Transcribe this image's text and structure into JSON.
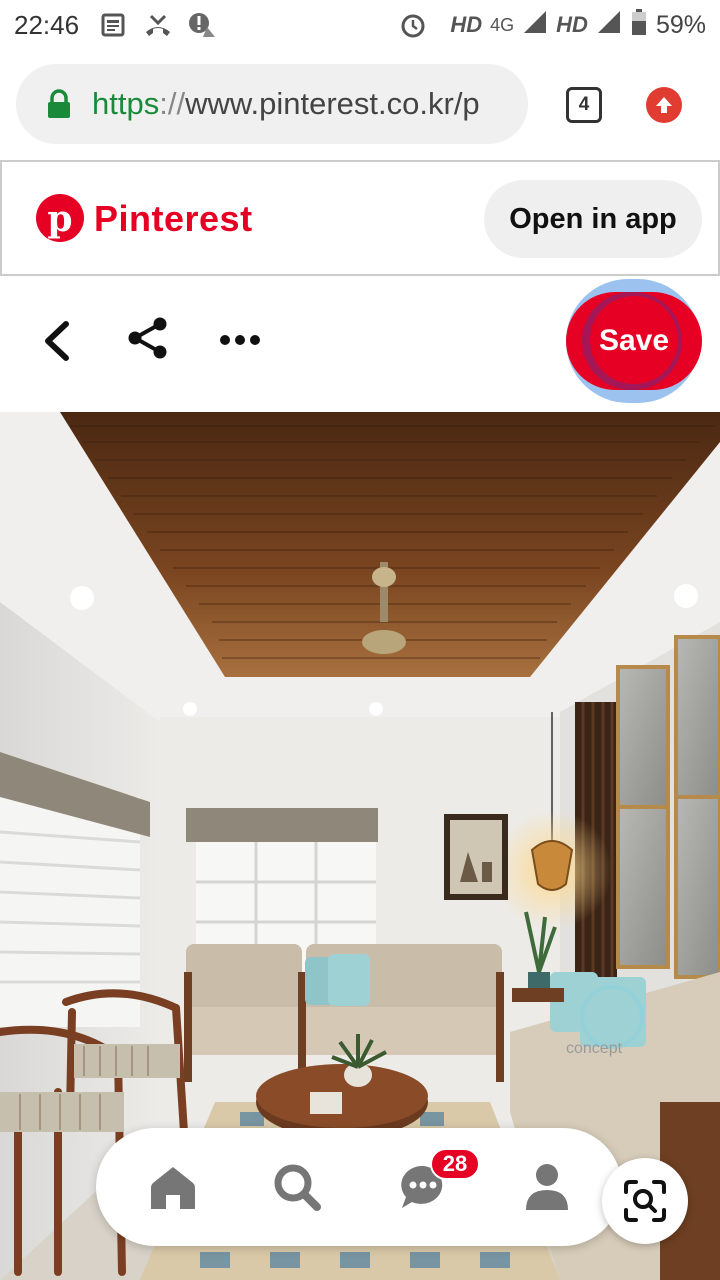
{
  "status_bar": {
    "time": "22:46",
    "network_1": "HD",
    "network_type": "4G",
    "network_2": "HD",
    "battery": "59%",
    "icons": [
      "news-icon",
      "missed-call-icon",
      "alert-icon",
      "alarm-icon",
      "signal-icon",
      "battery-icon"
    ]
  },
  "browser": {
    "url_scheme": "https",
    "url_sep": "://",
    "url_rest": "www.pinterest.co.kr/p",
    "tab_count": "4"
  },
  "pinterest": {
    "logo_letter": "p",
    "wordmark": "Pinterest",
    "open_in_app": "Open in app",
    "brand_color": "#e60023"
  },
  "actions": {
    "save_label": "Save"
  },
  "bottom_nav": {
    "items": [
      "home-icon",
      "search-icon",
      "messages-icon",
      "profile-icon"
    ],
    "message_badge": "28"
  },
  "photo": {
    "watermark": "concept"
  }
}
